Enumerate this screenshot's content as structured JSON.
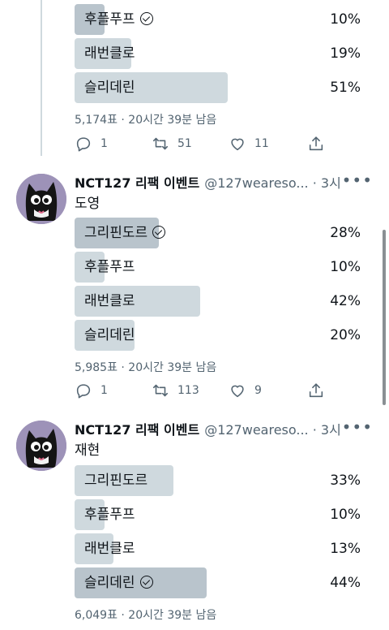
{
  "tweet_a": {
    "options": [
      {
        "label": "후플푸프",
        "pct": "10%",
        "fraction": 0.1,
        "winner": true
      },
      {
        "label": "래번클로",
        "pct": "19%",
        "fraction": 0.19,
        "winner": false
      },
      {
        "label": "슬리데린",
        "pct": "51%",
        "fraction": 0.51,
        "winner": false
      }
    ],
    "meta": "5,174표 · 20시간 39분 남음",
    "replies": "1",
    "retweets": "51",
    "likes": "11"
  },
  "tweet_b": {
    "author_name": "NCT127 리팩 이벤트",
    "handle": "@127weareso...",
    "time": "· 3시",
    "text": "도영",
    "options": [
      {
        "label": "그리핀도르",
        "pct": "28%",
        "fraction": 0.28,
        "winner": true
      },
      {
        "label": "후플푸프",
        "pct": "10%",
        "fraction": 0.1,
        "winner": false
      },
      {
        "label": "래번클로",
        "pct": "42%",
        "fraction": 0.42,
        "winner": false
      },
      {
        "label": "슬리데린",
        "pct": "20%",
        "fraction": 0.2,
        "winner": false
      }
    ],
    "meta": "5,985표 · 20시간 39분 남음",
    "replies": "1",
    "retweets": "113",
    "likes": "9"
  },
  "tweet_c": {
    "author_name": "NCT127 리팩 이벤트",
    "handle": "@127weareso...",
    "time": "· 3시",
    "text": "재현",
    "options": [
      {
        "label": "그리핀도르",
        "pct": "33%",
        "fraction": 0.33,
        "winner": false
      },
      {
        "label": "후플푸프",
        "pct": "10%",
        "fraction": 0.1,
        "winner": false
      },
      {
        "label": "래번클로",
        "pct": "13%",
        "fraction": 0.13,
        "winner": false
      },
      {
        "label": "슬리데린",
        "pct": "44%",
        "fraction": 0.44,
        "winner": true
      }
    ],
    "meta": "6,049표 · 20시간 39분 남음"
  },
  "icons": {
    "reply": "reply-icon",
    "retweet": "retweet-icon",
    "like": "heart-icon",
    "share": "share-icon",
    "more": "more-dots-icon",
    "check": "check-circle-icon"
  },
  "colors": {
    "poll_fill": "#cfd9de",
    "poll_fill_winner": "#b9c4cc",
    "secondary_text": "#536471",
    "primary_text": "#0f1419"
  }
}
